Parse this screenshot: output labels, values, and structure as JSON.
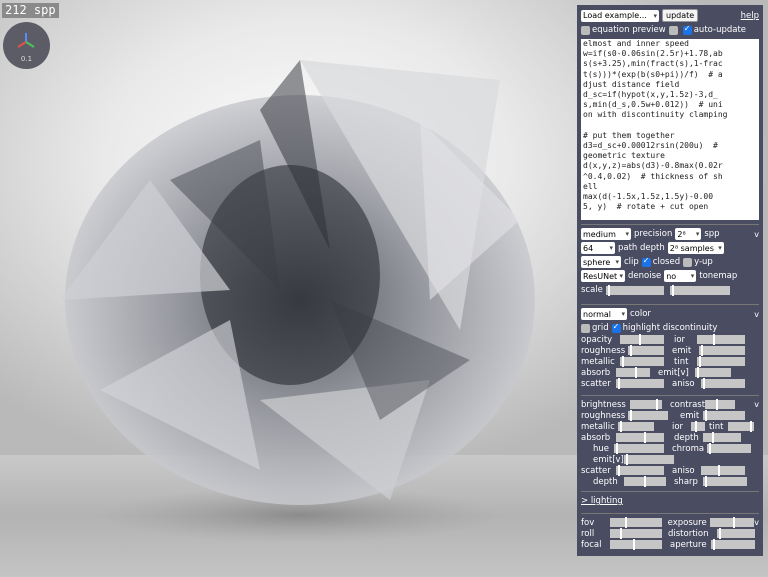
{
  "spp_text": "212 spp",
  "zoom_text": "0.1",
  "header": {
    "load_example": "Load example...",
    "update": "update",
    "help": "help",
    "equation_preview": "equation preview",
    "auto_update": "auto-update"
  },
  "code_lines": [
    "elmost and inner speed",
    "w=if(s0-0.06sin(2.5r)+1.78,ab",
    "s(s+3.25),min(fract(s),1-frac",
    "t(s)))*(exp(b(s0+pi))/f)  # a",
    "djust distance field",
    "d_sc=if(hypot(x,y,1.5z)-3,d_",
    "s,min(d_s,0.5w+0.012))  # uni",
    "on with discontinuity clamping",
    "",
    "# put them together",
    "d3=d_sc+0.00012rsin(200u)  #",
    "geometric texture",
    "d(x,y,z)=abs(d3)-0.8max(0.02r",
    "^0.4,0.02)  # thickness of sh",
    "ell",
    "max(d(-1.5x,1.5z,1.5y)-0.00",
    "5, y)  # rotate + cut open"
  ],
  "render": {
    "quality": "medium",
    "precision_label": "precision",
    "spp_val": "2⁸",
    "spp_label": "spp",
    "path_depth_val": "64",
    "path_depth_label": "path depth",
    "samples": "2⁸ samples",
    "bound": "sphere",
    "clip": "clip",
    "closed": "closed",
    "yup": "y-up",
    "denoiser": "ResUNet",
    "denoise_label": "denoise",
    "tonemap_val": "no",
    "tonemap_label": "tonemap",
    "scale": "scale",
    "collapse": "v"
  },
  "material": {
    "color_mode": "normal",
    "color_label": "color",
    "grid": "grid",
    "highlight": "highlight discontinuity",
    "opacity": "opacity",
    "ior": "ior",
    "roughness": "roughness",
    "emit": "emit",
    "metallic": "metallic",
    "tint": "tint",
    "absorb": "absorb",
    "emit_v": "emit[v]",
    "scatter": "scatter",
    "aniso": "aniso"
  },
  "sliders1": {
    "opacity": 0.45,
    "ior": 0.35,
    "roughness": 0.05,
    "emit": 0.05,
    "metallic": 0.05,
    "tint": 0.05,
    "absorb": 0.6,
    "emit_v": 0.05,
    "scatter": 0.05,
    "aniso": 0.05
  },
  "appearance": {
    "brightness": "brightness",
    "contrast": "contrast",
    "roughness": "roughness",
    "emit": "emit",
    "metallic": "metallic",
    "ior": "ior",
    "tint": "tint",
    "absorb": "absorb",
    "depth": "depth",
    "hue": "hue",
    "chroma": "chroma",
    "emit_v": "emit[v]",
    "scatter": "scatter",
    "aniso": "aniso",
    "depth2": "depth",
    "sharp": "sharp"
  },
  "sliders2": {
    "brightness": 0.85,
    "contrast": 0.4,
    "roughness": 0.05,
    "emit": 0.05,
    "metallic": 0.05,
    "ior": 0.35,
    "tint": 0.9,
    "absorb": 0.6,
    "depth": 0.25,
    "hue": 0.05,
    "chroma": 0.05,
    "emit_v": 0.05,
    "scatter": 0.05,
    "aniso": 0.4,
    "depth2": 0.5,
    "sharp": 0.05
  },
  "lighting": "> lighting",
  "camera": {
    "fov": "fov",
    "exposure": "exposure",
    "roll": "roll",
    "distortion": "distortion",
    "focal": "focal",
    "aperture": "aperture"
  },
  "sliders3": {
    "fov": 0.3,
    "exposure": 0.55,
    "roll": 0.2,
    "distortion": 0.05,
    "focal": 0.45,
    "aperture": 0.05
  }
}
